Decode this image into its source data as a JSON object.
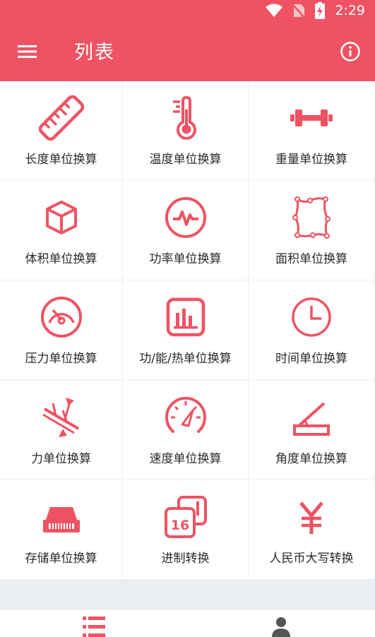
{
  "status": {
    "time": "2:29"
  },
  "appbar": {
    "title": "列表"
  },
  "colors": {
    "accent": "#ef5363",
    "grid_bg": "#eceff2",
    "inactive": "#555555"
  },
  "tools": [
    {
      "label": "长度单位换算",
      "icon": "ruler-icon"
    },
    {
      "label": "温度单位换算",
      "icon": "thermometer-icon"
    },
    {
      "label": "重量单位换算",
      "icon": "dumbbell-icon"
    },
    {
      "label": "体积单位换算",
      "icon": "cube-icon"
    },
    {
      "label": "功率单位换算",
      "icon": "pulse-icon"
    },
    {
      "label": "面积单位换算",
      "icon": "area-icon"
    },
    {
      "label": "压力单位换算",
      "icon": "gauge-icon"
    },
    {
      "label": "功/能/热单位换算",
      "icon": "bar-chart-icon"
    },
    {
      "label": "时间单位换算",
      "icon": "clock-icon"
    },
    {
      "label": "力单位换算",
      "icon": "force-icon"
    },
    {
      "label": "速度单位换算",
      "icon": "speedometer-icon"
    },
    {
      "label": "角度单位换算",
      "icon": "angle-icon"
    },
    {
      "label": "存储单位换算",
      "icon": "storage-icon"
    },
    {
      "label": "进制转换",
      "icon": "number-base-icon"
    },
    {
      "label": "人民币大写转换",
      "icon": "yuan-icon"
    }
  ],
  "bottom_nav": [
    {
      "icon": "list-icon",
      "active": true
    },
    {
      "icon": "person-icon",
      "active": false
    }
  ]
}
